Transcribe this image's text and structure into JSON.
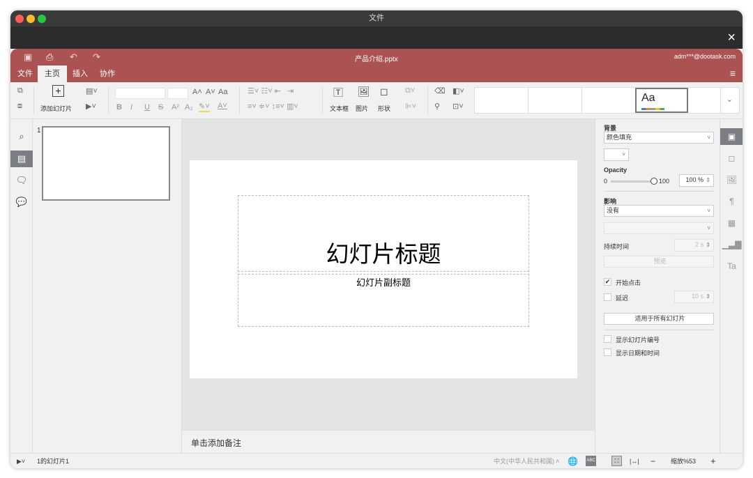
{
  "window": {
    "title": "文件",
    "close": "×"
  },
  "header": {
    "file_name": "产品介绍.pptx",
    "user": "adm***@dootask.com",
    "icons": [
      "save-icon",
      "print-icon",
      "undo-icon",
      "redo-icon",
      "hamburger-menu-icon"
    ]
  },
  "tabs": [
    {
      "label": "文件"
    },
    {
      "label": "主页",
      "active": true
    },
    {
      "label": "插入"
    },
    {
      "label": "协作"
    }
  ],
  "toolbar": {
    "add_slide": "添加幻灯片",
    "text_box": "文本框",
    "image": "图片",
    "shape": "形状",
    "theme_sample": "Aa",
    "font_grow": "A˄",
    "font_shrink": "A˅",
    "change_case": "Aa",
    "bold": "B",
    "italic": "I",
    "underline": "U",
    "strike": "S",
    "superscript": "A²",
    "subscript": "A₂"
  },
  "thumbnails": [
    {
      "number": "1"
    }
  ],
  "slide": {
    "title": "幻灯片标题",
    "subtitle": "幻灯片副标题"
  },
  "notes": {
    "placeholder": "单击添加备注"
  },
  "right_panel": {
    "background_label": "背景",
    "fill_value": "颜色填充",
    "opacity_label": "Opacity",
    "opacity_min": "0",
    "opacity_max": "100",
    "opacity_value": "100 %",
    "opacity_fraction": 1.0,
    "effect_label": "影响",
    "effect_value": "没有",
    "effect_sub": "",
    "duration_label": "持续时间",
    "duration_value": "2 s",
    "preview": "预览",
    "start_on_click": "开始点击",
    "start_on_click_checked": true,
    "delay": "延迟",
    "delay_checked": false,
    "delay_value": "10 s",
    "apply_all": "适用于所有幻灯片",
    "show_slide_number": "显示幻灯片编号",
    "show_date_time": "显示日期和时间"
  },
  "status": {
    "slide_info": "1的幻灯片1",
    "language": "中文(中华人民共和国)",
    "zoom": "缩放%53",
    "minus": "−",
    "plus": "+"
  },
  "colors": {
    "brand": "#ab5252",
    "toolbar": "#f1f1f1",
    "canvas": "#e4e4e4"
  }
}
